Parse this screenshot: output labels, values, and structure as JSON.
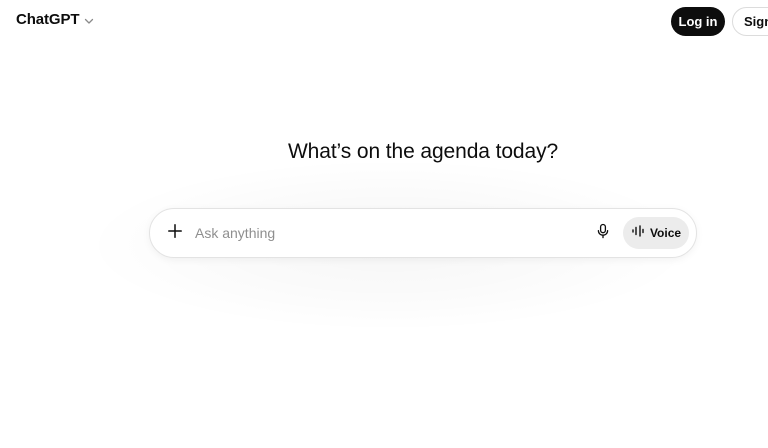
{
  "header": {
    "model_name": "ChatGPT",
    "login_label": "Log in",
    "signup_label": "Sign up"
  },
  "main": {
    "headline": "What’s on the agenda today?"
  },
  "composer": {
    "placeholder": "Ask anything",
    "value": "",
    "voice_label": "Voice"
  },
  "icons": {
    "model_dropdown": "chevron-down-icon",
    "attach": "plus-icon",
    "dictate": "microphone-icon",
    "voice": "waveform-icon"
  },
  "colors": {
    "primary_button_bg": "#0d0d0d",
    "voice_button_bg": "#ececec",
    "placeholder_text": "#8f8f8f"
  }
}
